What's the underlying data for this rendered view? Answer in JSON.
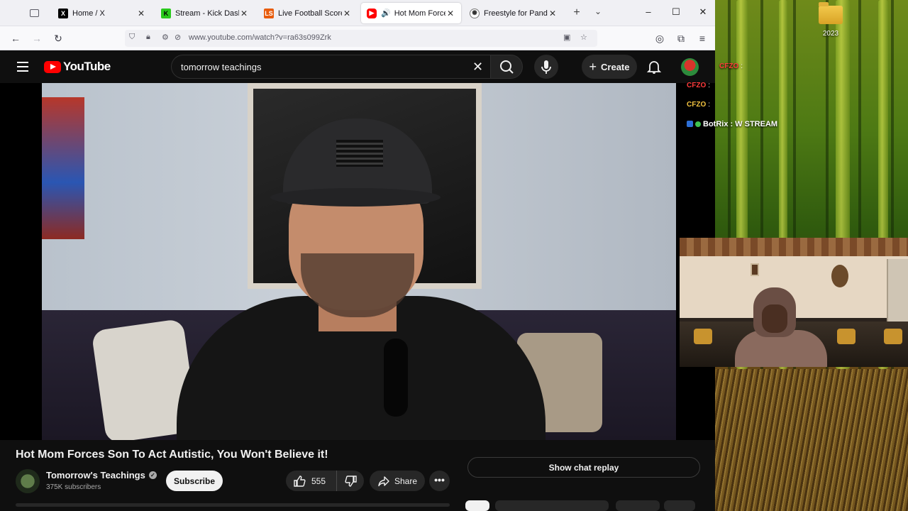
{
  "browser": {
    "tabs": [
      {
        "title": "Home / X",
        "favicon": "x-logo"
      },
      {
        "title": "Stream - Kick Dashbo",
        "favicon": "kick-logo"
      },
      {
        "title": "Live Football Scores, F",
        "favicon": "livescore-logo"
      },
      {
        "title": "Hot Mom Forces",
        "favicon": "youtube-logo",
        "active": true,
        "playing_audio": true
      },
      {
        "title": "Freestyle for Panda",
        "favicon": "openai-logo"
      }
    ],
    "url": "www.youtube.com/watch?v=ra63s099Zrk"
  },
  "youtube": {
    "logo_text": "YouTube",
    "search_query": "tomorrow teachings",
    "create_label": "Create",
    "video": {
      "title": "Hot Mom Forces Son To Act Autistic, You Won't Believe it!",
      "channel_name": "Tomorrow's Teachings",
      "subscribers": "375K subscribers",
      "subscribe_label": "Subscribe",
      "likes": "555",
      "share_label": "Share",
      "more_label": "•••"
    },
    "chat_replay_label": "Show chat replay"
  },
  "desktop": {
    "folder_label": "2023"
  },
  "stream_overlay": {
    "chat": [
      {
        "user": "CFZO",
        "text": ":"
      },
      {
        "user": "CFZO",
        "text": ":"
      },
      {
        "user": "CFZO",
        "text": ":"
      },
      {
        "user": "BotRix",
        "text": ": W STREAM"
      }
    ]
  },
  "colors": {
    "youtube_red": "#ff0000",
    "yt_bg": "#0f0f0f",
    "button_bg": "#272727"
  }
}
